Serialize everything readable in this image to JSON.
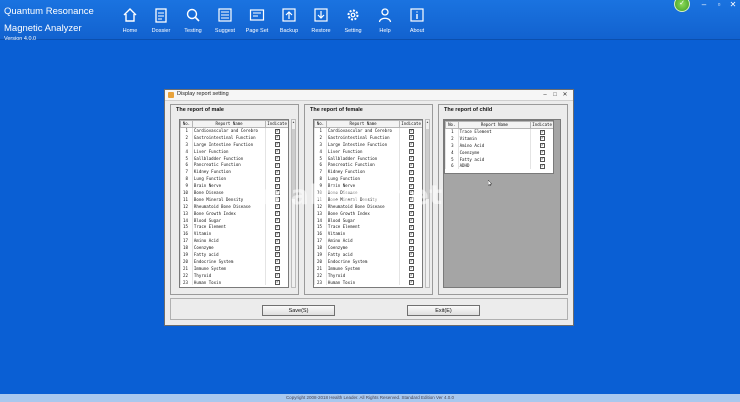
{
  "app": {
    "title_line1": "Quantum Resonance",
    "title_line2": "Magnetic Analyzer",
    "version": "Version 4.0.0"
  },
  "toolbar": [
    {
      "label": "Home",
      "icon": "home-icon"
    },
    {
      "label": "Dossier",
      "icon": "clipboard-icon"
    },
    {
      "label": "Testing",
      "icon": "search-icon"
    },
    {
      "label": "Suggest",
      "icon": "list-icon"
    },
    {
      "label": "Page Set",
      "icon": "page-icon"
    },
    {
      "label": "Backup",
      "icon": "upload-icon"
    },
    {
      "label": "Restore",
      "icon": "download-icon"
    },
    {
      "label": "Setting",
      "icon": "gear-icon"
    },
    {
      "label": "Help",
      "icon": "user-icon"
    },
    {
      "label": "About",
      "icon": "info-icon"
    }
  ],
  "dialog": {
    "title": "Display report setting",
    "save_label": "Save(S)",
    "exit_label": "Exit(E)",
    "columns": {
      "no": "No.",
      "name": "Report Name",
      "indicate": "Indicate"
    },
    "male": {
      "title": "The report of male",
      "rows": [
        {
          "no": "1",
          "name": "Cardiovascular and Cerebro",
          "checked": true
        },
        {
          "no": "2",
          "name": "Gastrointestinal Function",
          "checked": true
        },
        {
          "no": "3",
          "name": "Large Intestine Function",
          "checked": true
        },
        {
          "no": "4",
          "name": "Liver Function",
          "checked": true
        },
        {
          "no": "5",
          "name": "Gallbladder Function",
          "checked": true
        },
        {
          "no": "6",
          "name": "Pancreatic Function",
          "checked": true
        },
        {
          "no": "7",
          "name": "Kidney Function",
          "checked": true
        },
        {
          "no": "8",
          "name": "Lung Function",
          "checked": true
        },
        {
          "no": "9",
          "name": "Brain Nerve",
          "checked": true
        },
        {
          "no": "10",
          "name": "Bone Disease",
          "checked": true
        },
        {
          "no": "11",
          "name": "Bone Mineral Density",
          "checked": true
        },
        {
          "no": "12",
          "name": "Rheumatoid Bone Disease",
          "checked": true
        },
        {
          "no": "13",
          "name": "Bone Growth Index",
          "checked": true
        },
        {
          "no": "14",
          "name": "Blood Sugar",
          "checked": true
        },
        {
          "no": "15",
          "name": "Trace Element",
          "checked": true
        },
        {
          "no": "16",
          "name": "Vitamin",
          "checked": true
        },
        {
          "no": "17",
          "name": "Amino Acid",
          "checked": true
        },
        {
          "no": "18",
          "name": "Coenzyme",
          "checked": true
        },
        {
          "no": "19",
          "name": "Fatty acid",
          "checked": true
        },
        {
          "no": "20",
          "name": "Endocrine System",
          "checked": true
        },
        {
          "no": "21",
          "name": "Immune System",
          "checked": true
        },
        {
          "no": "22",
          "name": "Thyroid",
          "checked": true
        },
        {
          "no": "23",
          "name": "Human Toxin",
          "checked": true
        }
      ]
    },
    "female": {
      "title": "The report of female",
      "rows": [
        {
          "no": "1",
          "name": "Cardiovascular and Cerebro",
          "checked": true
        },
        {
          "no": "2",
          "name": "Gastrointestinal Function",
          "checked": true
        },
        {
          "no": "3",
          "name": "Large Intestine Function",
          "checked": true
        },
        {
          "no": "4",
          "name": "Liver Function",
          "checked": true
        },
        {
          "no": "5",
          "name": "Gallbladder Function",
          "checked": true
        },
        {
          "no": "6",
          "name": "Pancreatic Function",
          "checked": true
        },
        {
          "no": "7",
          "name": "Kidney Function",
          "checked": true
        },
        {
          "no": "8",
          "name": "Lung Function",
          "checked": true
        },
        {
          "no": "9",
          "name": "Brain Nerve",
          "checked": true
        },
        {
          "no": "10",
          "name": "Bone Disease",
          "checked": true
        },
        {
          "no": "11",
          "name": "Bone Mineral Density",
          "checked": true
        },
        {
          "no": "12",
          "name": "Rheumatoid Bone Disease",
          "checked": true
        },
        {
          "no": "13",
          "name": "Bone Growth Index",
          "checked": true
        },
        {
          "no": "14",
          "name": "Blood Sugar",
          "checked": true
        },
        {
          "no": "15",
          "name": "Trace Element",
          "checked": true
        },
        {
          "no": "16",
          "name": "Vitamin",
          "checked": true
        },
        {
          "no": "17",
          "name": "Amino Acid",
          "checked": true
        },
        {
          "no": "18",
          "name": "Coenzyme",
          "checked": true
        },
        {
          "no": "19",
          "name": "Fatty acid",
          "checked": true
        },
        {
          "no": "20",
          "name": "Endocrine System",
          "checked": true
        },
        {
          "no": "21",
          "name": "Immune System",
          "checked": true
        },
        {
          "no": "22",
          "name": "Thyroid",
          "checked": true
        },
        {
          "no": "23",
          "name": "Human Toxin",
          "checked": true
        }
      ]
    },
    "child": {
      "title": "The report of child",
      "rows": [
        {
          "no": "1",
          "name": "Trace Element",
          "checked": true
        },
        {
          "no": "2",
          "name": "Vitamin",
          "checked": true
        },
        {
          "no": "3",
          "name": "Amino Acid",
          "checked": true
        },
        {
          "no": "4",
          "name": "Coenzyme",
          "checked": true
        },
        {
          "no": "5",
          "name": "Fatty acid",
          "checked": true
        },
        {
          "no": "6",
          "name": "ADHD",
          "checked": true
        }
      ]
    }
  },
  "watermark": "makton.net",
  "footer": "Copyright 2008-2018 Health Leader. All Rights Reserved. Standard Edition Ver 4.0.0"
}
